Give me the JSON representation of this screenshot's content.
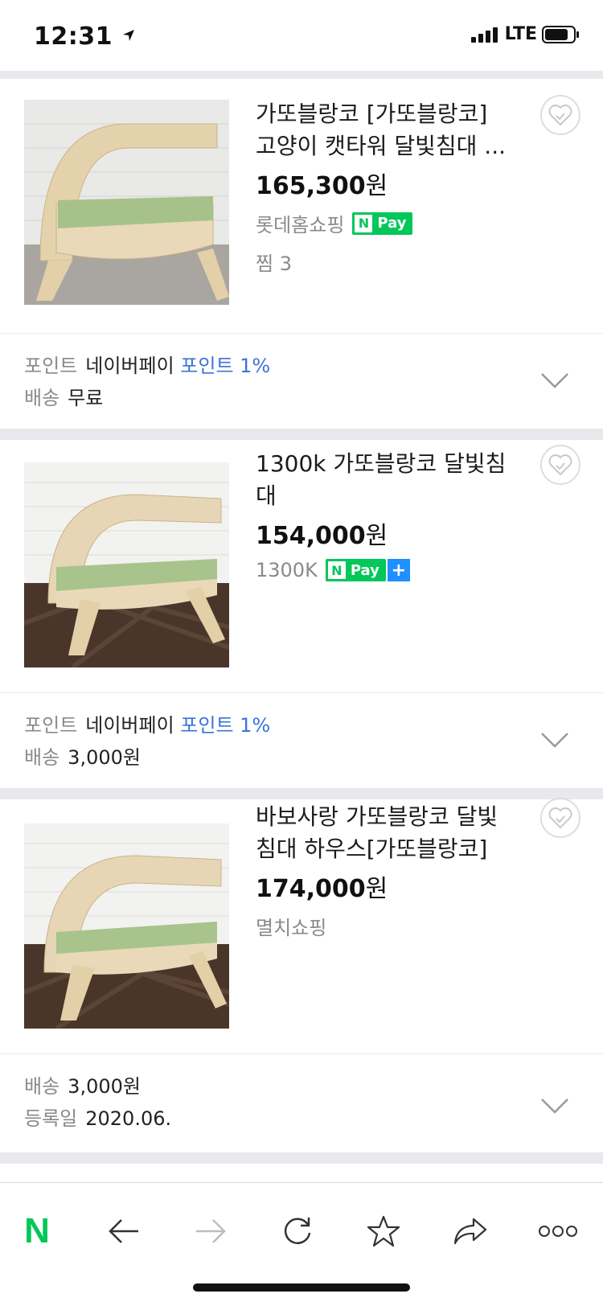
{
  "status": {
    "time": "12:31",
    "network": "LTE"
  },
  "products": [
    {
      "title_line1": "가또블랑코 [가또블랑코]",
      "title_line2": "고양이 캣타워 달빛침대 ...",
      "price_value": "165,300",
      "price_unit": "원",
      "seller": "롯데홈쇼핑",
      "npay": "Pay",
      "wish": "찜 3",
      "row1_label": "포인트",
      "row1_value": "네이버페이",
      "row1_highlight": "포인트 1%",
      "row2_label": "배송",
      "row2_value": "무료"
    },
    {
      "title_line1": "1300k 가또블랑코 달빛침",
      "title_line2": "대",
      "price_value": "154,000",
      "price_unit": "원",
      "seller": "1300K",
      "npay": "Pay",
      "row1_label": "포인트",
      "row1_value": "네이버페이",
      "row1_highlight": "포인트 1%",
      "row2_label": "배송",
      "row2_value": "3,000원"
    },
    {
      "title_line1": "바보사랑 가또블랑코 달빛",
      "title_line2": "침대 하우스[가또블랑코]",
      "price_value": "174,000",
      "price_unit": "원",
      "seller": "멸치쇼핑",
      "row1_label": "배송",
      "row1_value": "3,000원",
      "row2_label": "등록일",
      "row2_value": "2020.06."
    }
  ],
  "toolbar": {
    "home_label": "N",
    "items": [
      "back-icon",
      "forward-icon",
      "refresh-icon",
      "bookmark-star-icon",
      "share-icon",
      "more-icon"
    ]
  },
  "colors": {
    "naver_green": "#03c75a",
    "link_blue": "#3b73d9",
    "band_gray": "#e8e9ed"
  }
}
